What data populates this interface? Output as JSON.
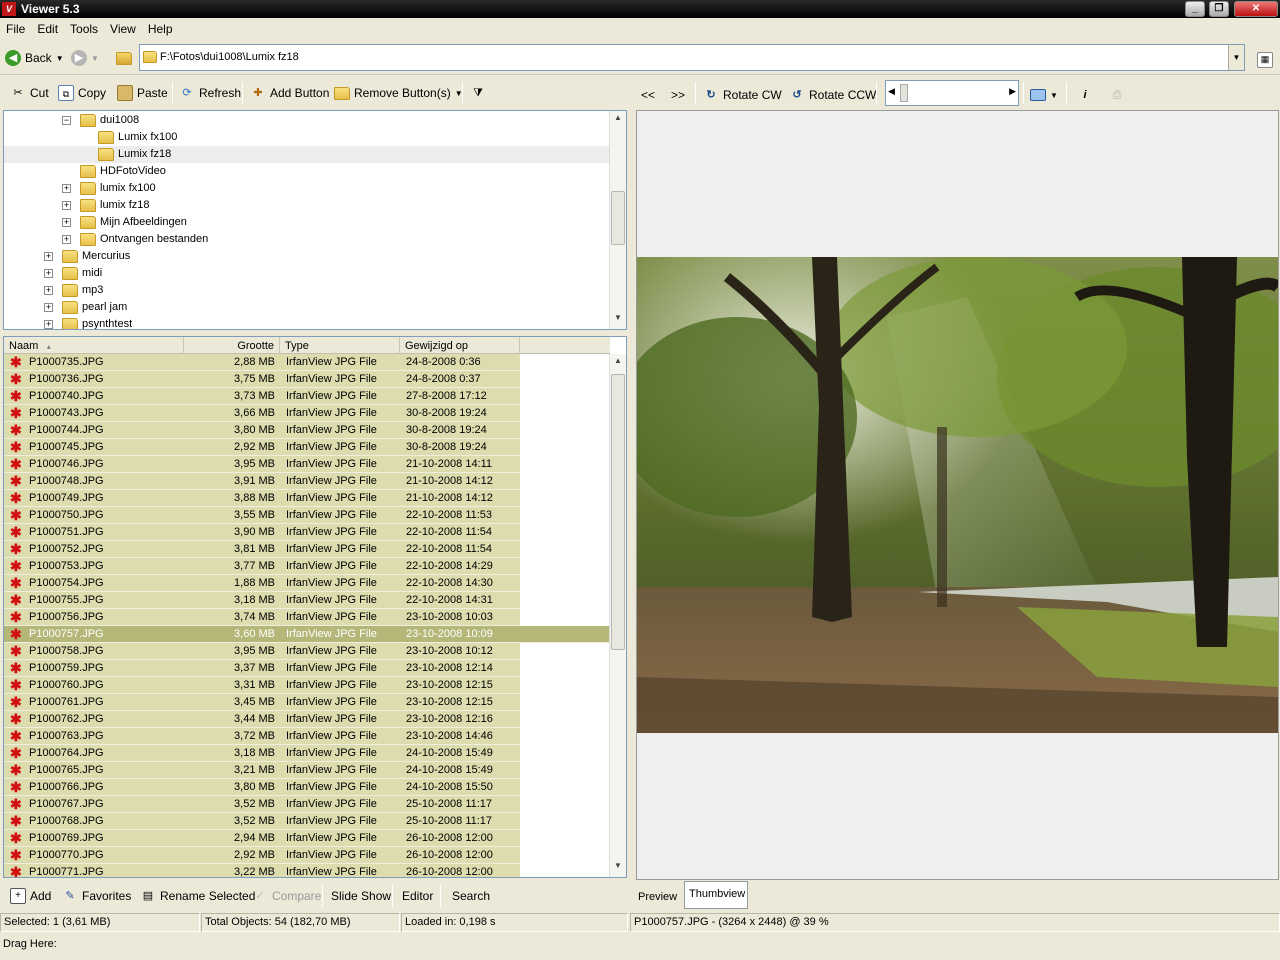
{
  "app": {
    "title": "Viewer 5.3",
    "icon_letter": "V"
  },
  "menu": [
    "File",
    "Edit",
    "Tools",
    "View",
    "Help"
  ],
  "address": {
    "back_label": "Back",
    "path": "F:\\Fotos\\dui1008\\Lumix fz18"
  },
  "left_toolbar": {
    "cut": "Cut",
    "copy": "Copy",
    "paste": "Paste",
    "refresh": "Refresh",
    "add_button": "Add Button",
    "remove_buttons": "Remove Button(s)"
  },
  "right_toolbar": {
    "prev": "<<",
    "next": ">>",
    "rotate_cw": "Rotate CW",
    "rotate_ccw": "Rotate CCW"
  },
  "tree": [
    {
      "label": "dui1008",
      "indent": 2,
      "toggle": "−",
      "selected": false
    },
    {
      "label": "Lumix fx100",
      "indent": 3,
      "toggle": "",
      "selected": false
    },
    {
      "label": "Lumix fz18",
      "indent": 3,
      "toggle": "",
      "selected": true
    },
    {
      "label": "HDFotoVideo",
      "indent": 2,
      "toggle": "",
      "selected": false
    },
    {
      "label": "lumix fx100",
      "indent": 2,
      "toggle": "+",
      "selected": false
    },
    {
      "label": "lumix fz18",
      "indent": 2,
      "toggle": "+",
      "selected": false
    },
    {
      "label": "Mijn Afbeeldingen",
      "indent": 2,
      "toggle": "+",
      "selected": false
    },
    {
      "label": "Ontvangen bestanden",
      "indent": 2,
      "toggle": "+",
      "selected": false
    },
    {
      "label": "Mercurius",
      "indent": 1,
      "toggle": "+",
      "selected": false
    },
    {
      "label": "midi",
      "indent": 1,
      "toggle": "+",
      "selected": false
    },
    {
      "label": "mp3",
      "indent": 1,
      "toggle": "+",
      "selected": false
    },
    {
      "label": "pearl jam",
      "indent": 1,
      "toggle": "+",
      "selected": false
    },
    {
      "label": "psynthtest",
      "indent": 1,
      "toggle": "+",
      "selected": false
    }
  ],
  "list": {
    "headers": {
      "name": "Naam",
      "size": "Grootte",
      "type": "Type",
      "modified": "Gewijzigd op"
    },
    "selected_index": 16,
    "rows": [
      [
        "P1000735.JPG",
        "2,88 MB",
        "IrfanView JPG File",
        "24-8-2008 0:36"
      ],
      [
        "P1000736.JPG",
        "3,75 MB",
        "IrfanView JPG File",
        "24-8-2008 0:37"
      ],
      [
        "P1000740.JPG",
        "3,73 MB",
        "IrfanView JPG File",
        "27-8-2008 17:12"
      ],
      [
        "P1000743.JPG",
        "3,66 MB",
        "IrfanView JPG File",
        "30-8-2008 19:24"
      ],
      [
        "P1000744.JPG",
        "3,80 MB",
        "IrfanView JPG File",
        "30-8-2008 19:24"
      ],
      [
        "P1000745.JPG",
        "2,92 MB",
        "IrfanView JPG File",
        "30-8-2008 19:24"
      ],
      [
        "P1000746.JPG",
        "3,95 MB",
        "IrfanView JPG File",
        "21-10-2008 14:11"
      ],
      [
        "P1000748.JPG",
        "3,91 MB",
        "IrfanView JPG File",
        "21-10-2008 14:12"
      ],
      [
        "P1000749.JPG",
        "3,88 MB",
        "IrfanView JPG File",
        "21-10-2008 14:12"
      ],
      [
        "P1000750.JPG",
        "3,55 MB",
        "IrfanView JPG File",
        "22-10-2008 11:53"
      ],
      [
        "P1000751.JPG",
        "3,90 MB",
        "IrfanView JPG File",
        "22-10-2008 11:54"
      ],
      [
        "P1000752.JPG",
        "3,81 MB",
        "IrfanView JPG File",
        "22-10-2008 11:54"
      ],
      [
        "P1000753.JPG",
        "3,77 MB",
        "IrfanView JPG File",
        "22-10-2008 14:29"
      ],
      [
        "P1000754.JPG",
        "1,88 MB",
        "IrfanView JPG File",
        "22-10-2008 14:30"
      ],
      [
        "P1000755.JPG",
        "3,18 MB",
        "IrfanView JPG File",
        "22-10-2008 14:31"
      ],
      [
        "P1000756.JPG",
        "3,74 MB",
        "IrfanView JPG File",
        "23-10-2008 10:03"
      ],
      [
        "P1000757.JPG",
        "3,60 MB",
        "IrfanView JPG File",
        "23-10-2008 10:09"
      ],
      [
        "P1000758.JPG",
        "3,95 MB",
        "IrfanView JPG File",
        "23-10-2008 10:12"
      ],
      [
        "P1000759.JPG",
        "3,37 MB",
        "IrfanView JPG File",
        "23-10-2008 12:14"
      ],
      [
        "P1000760.JPG",
        "3,31 MB",
        "IrfanView JPG File",
        "23-10-2008 12:15"
      ],
      [
        "P1000761.JPG",
        "3,45 MB",
        "IrfanView JPG File",
        "23-10-2008 12:15"
      ],
      [
        "P1000762.JPG",
        "3,44 MB",
        "IrfanView JPG File",
        "23-10-2008 12:16"
      ],
      [
        "P1000763.JPG",
        "3,72 MB",
        "IrfanView JPG File",
        "23-10-2008 14:46"
      ],
      [
        "P1000764.JPG",
        "3,18 MB",
        "IrfanView JPG File",
        "24-10-2008 15:49"
      ],
      [
        "P1000765.JPG",
        "3,21 MB",
        "IrfanView JPG File",
        "24-10-2008 15:49"
      ],
      [
        "P1000766.JPG",
        "3,80 MB",
        "IrfanView JPG File",
        "24-10-2008 15:50"
      ],
      [
        "P1000767.JPG",
        "3,52 MB",
        "IrfanView JPG File",
        "25-10-2008 11:17"
      ],
      [
        "P1000768.JPG",
        "3,52 MB",
        "IrfanView JPG File",
        "25-10-2008 11:17"
      ],
      [
        "P1000769.JPG",
        "2,94 MB",
        "IrfanView JPG File",
        "26-10-2008 12:00"
      ],
      [
        "P1000770.JPG",
        "2,92 MB",
        "IrfanView JPG File",
        "26-10-2008 12:00"
      ],
      [
        "P1000771.JPG",
        "3,22 MB",
        "IrfanView JPG File",
        "26-10-2008 12:00"
      ]
    ]
  },
  "bottom_toolbar": {
    "add": "Add",
    "favorites": "Favorites",
    "rename": "Rename Selected",
    "compare": "Compare",
    "slideshow": "Slide Show",
    "editor": "Editor",
    "search": "Search"
  },
  "tabs": {
    "preview": "Preview",
    "thumbview": "Thumbview"
  },
  "status": {
    "selected": "Selected: 1 (3,61 MB)",
    "total": "Total Objects: 54 (182,70 MB)",
    "loaded": "Loaded in: 0,198 s",
    "image_info": "P1000757.JPG -  (3264 x 2448) @ 39  %",
    "drag": "Drag Here:"
  },
  "colors": {
    "list_bg": "#dddcae",
    "list_selected": "#b4b778",
    "titlebar": "#000000"
  }
}
